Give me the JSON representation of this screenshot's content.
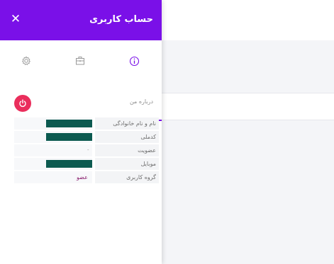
{
  "panel": {
    "title": "حساب کاربری",
    "close_glyph": "✕",
    "accent_color": "#7a10e8",
    "power_color": "#ea2e5c"
  },
  "tabs": [
    {
      "icon": "gear-icon"
    },
    {
      "icon": "briefcase-icon"
    },
    {
      "icon": "info-icon",
      "active": true
    }
  ],
  "about": {
    "heading": "درباره من"
  },
  "info_rows": [
    {
      "label": "نام و نام خانوادگی",
      "value": "",
      "masked": true
    },
    {
      "label": "کدملی",
      "value": "",
      "masked": true
    },
    {
      "label": "عضویت",
      "value": "-",
      "masked": false
    },
    {
      "label": "موبایل",
      "value": "",
      "masked": true
    },
    {
      "label": "گروه کاربری",
      "value": "عضو",
      "masked": false
    }
  ]
}
